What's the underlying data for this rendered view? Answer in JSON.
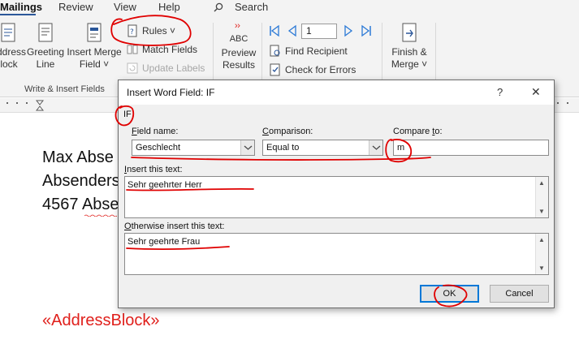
{
  "ribbon": {
    "tabs": [
      "Mailings",
      "Review",
      "View",
      "Help"
    ],
    "search_label": "Search",
    "address_block": [
      "ddress",
      "lock"
    ],
    "greeting_line": [
      "Greeting",
      "Line"
    ],
    "insert_merge_field": [
      "Insert Merge",
      "Field ˅"
    ],
    "rules_label": "Rules ˅",
    "match_fields_label": "Match Fields",
    "update_labels_label": "Update Labels",
    "group_write_insert": "Write & Insert Fields",
    "preview_abc": "ABC",
    "preview_results": [
      "Preview",
      "Results"
    ],
    "record_number": "1",
    "find_recipient_label": "Find Recipient",
    "check_errors_label": "Check for Errors",
    "finish_merge": [
      "Finish &",
      "Merge ˅"
    ]
  },
  "document": {
    "lines": [
      "Max Abse",
      "Absenders",
      "4567 Abse"
    ],
    "merge_field": "«AddressBlock»"
  },
  "dialog": {
    "title": "Insert Word Field: IF",
    "help": "?",
    "close": "✕",
    "field_tag": "IF",
    "field_name_label": "ield name:",
    "field_name_ul": "F",
    "field_name_value": "Geschlecht",
    "comparison_label": "omparison:",
    "comparison_ul": "C",
    "comparison_value": "Equal to",
    "compare_to_label_pre": "Compare ",
    "compare_to_ul": "t",
    "compare_to_label_post": "o:",
    "compare_to_value": "m",
    "insert_text_ul": "I",
    "insert_text_label": "nsert this text:",
    "insert_text_value": "Sehr geehrter Herr",
    "otherwise_ul": "O",
    "otherwise_label": "therwise insert this text:",
    "otherwise_value": "Sehr geehrte Frau",
    "ok_label": "OK",
    "cancel_label": "Cancel"
  },
  "colors": {
    "accent": "#2b579a",
    "merge_field": "#e0201c",
    "annotation": "#e00000",
    "ok_border": "#0078d7"
  }
}
